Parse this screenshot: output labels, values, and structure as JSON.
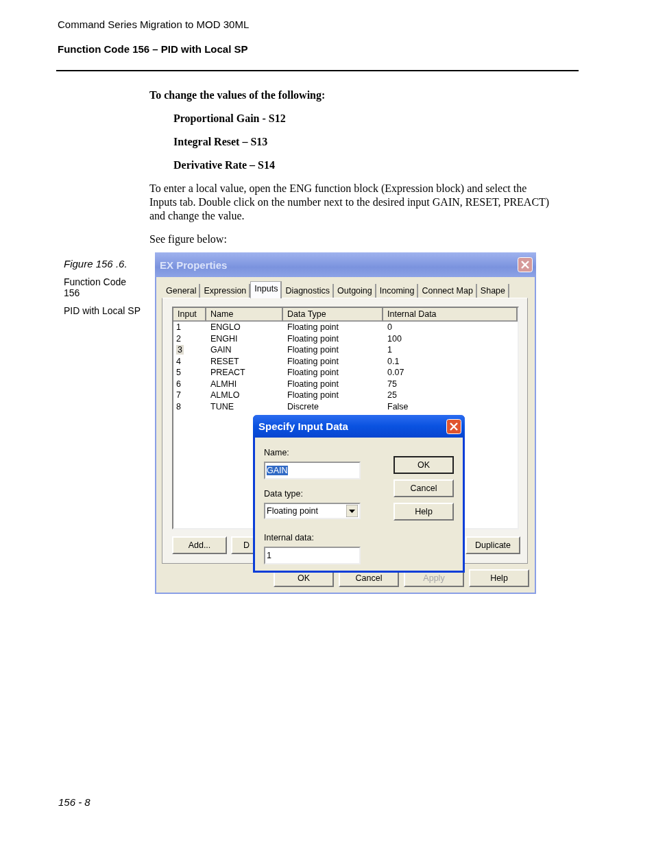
{
  "header": {
    "title": "Command Series Migration to MOD 30ML",
    "section": "Function Code 156 – PID with Local SP"
  },
  "body": {
    "lead": "To change the values of the following:",
    "items": [
      "Proportional Gain - S12",
      "Integral Reset – S13",
      "Derivative Rate – S14"
    ],
    "paragraph": "To enter a local value, open the ENG function block (Expression block) and select the Inputs tab. Double click on the number next to the desired input GAIN, RESET, PREACT) and change the value.",
    "see": "See figure below:"
  },
  "figure": {
    "caption": "Figure 156 .6.",
    "lines": [
      "Function Code 156",
      "PID with Local SP"
    ]
  },
  "window": {
    "title": "EX Properties",
    "tabs": [
      {
        "label": "General",
        "selected": false
      },
      {
        "label": "Expression",
        "selected": false
      },
      {
        "label": "Inputs",
        "selected": true
      },
      {
        "label": "Diagnostics",
        "selected": false
      },
      {
        "label": "Outgoing",
        "selected": false
      },
      {
        "label": "Incoming",
        "selected": false
      },
      {
        "label": "Connect Map",
        "selected": false
      },
      {
        "label": "Shape",
        "selected": false
      }
    ],
    "columns": [
      "Input",
      "Name",
      "Data Type",
      "Internal Data"
    ],
    "rows": [
      {
        "input": "1",
        "name": "ENGLO",
        "data_type": "Floating point",
        "internal_data": "0",
        "selected": false
      },
      {
        "input": "2",
        "name": "ENGHI",
        "data_type": "Floating point",
        "internal_data": "100",
        "selected": false
      },
      {
        "input": "3",
        "name": "GAIN",
        "data_type": "Floating point",
        "internal_data": "1",
        "selected": true
      },
      {
        "input": "4",
        "name": "RESET",
        "data_type": "Floating point",
        "internal_data": "0.1",
        "selected": false
      },
      {
        "input": "5",
        "name": "PREACT",
        "data_type": "Floating point",
        "internal_data": "0.07",
        "selected": false
      },
      {
        "input": "6",
        "name": "ALMHI",
        "data_type": "Floating point",
        "internal_data": "75",
        "selected": false
      },
      {
        "input": "7",
        "name": "ALMLO",
        "data_type": "Floating point",
        "internal_data": "25",
        "selected": false
      },
      {
        "input": "8",
        "name": "TUNE",
        "data_type": "Discrete",
        "internal_data": "False",
        "selected": false
      }
    ],
    "list_buttons": [
      {
        "label": "Add...",
        "kind": "full"
      },
      {
        "label": "D",
        "kind": "covered"
      },
      {
        "label": "Duplicate",
        "kind": "right"
      }
    ],
    "buttons": [
      {
        "label": "OK",
        "disabled": false
      },
      {
        "label": "Cancel",
        "disabled": false
      },
      {
        "label": "Apply",
        "disabled": true
      },
      {
        "label": "Help",
        "disabled": false
      }
    ]
  },
  "dialog": {
    "title": "Specify Input Data",
    "name_label": "Name:",
    "name_value": "GAIN",
    "name_value_selected": true,
    "type_label": "Data type:",
    "type_value": "Floating point",
    "data_label": "Internal data:",
    "data_value": "1",
    "buttons": [
      {
        "label": "OK",
        "default": true
      },
      {
        "label": "Cancel",
        "default": false
      },
      {
        "label": "Help",
        "default": false
      }
    ]
  },
  "footer": {
    "page": "156 - 8"
  }
}
